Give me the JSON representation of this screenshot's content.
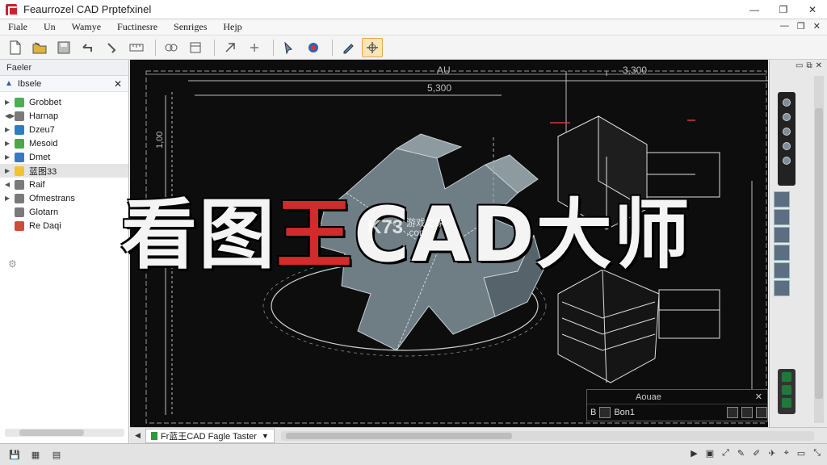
{
  "window": {
    "title": "Feaurrozel CAD Prptefxinel"
  },
  "menu": {
    "items": [
      "Fiale",
      "Un",
      "Wamye",
      "Fuctinesre",
      "Senriges",
      "Hejp"
    ]
  },
  "left_panel": {
    "header": "Faeler",
    "top_label": "Ibsele",
    "items": [
      {
        "label": "Grobbet",
        "color": "#4caf50"
      },
      {
        "label": "Harnap",
        "color": "#7a7a7a"
      },
      {
        "label": "Dzeu7",
        "color": "#2c7fbf"
      },
      {
        "label": "Mesoid",
        "color": "#49a84a"
      },
      {
        "label": "Dmet",
        "color": "#3b78c3"
      },
      {
        "label": "蓝图33",
        "color": "#f0c330",
        "selected": true
      },
      {
        "label": "Raif",
        "color": "#7a7a7a"
      },
      {
        "label": "Ofmestrans",
        "color": "#7a7a7a"
      },
      {
        "label": "Glotarn",
        "color": "#7a7a7a"
      },
      {
        "label": "Re Daqi",
        "color": "#d24a3a"
      }
    ]
  },
  "canvas": {
    "dim_top": "AU",
    "dim_top2": "5,300",
    "dim_right": "3,300",
    "dim_left": "1,00",
    "overlay": {
      "p1": "看图",
      "p2": "王",
      "p3": "CAD大师"
    },
    "watermark": {
      "logo": "K73",
      "sub1": "游戏之家",
      "sub2": ".com"
    }
  },
  "palette": {
    "title": "Aouae",
    "field": "Bon1",
    "prefix": "B"
  },
  "bottom_tab": {
    "label": "Fr蓝王CAD Fagle Taster"
  },
  "icons": {
    "colors": {
      "accent": "#d12b2b",
      "active_tool": "#fbe4b9"
    }
  }
}
